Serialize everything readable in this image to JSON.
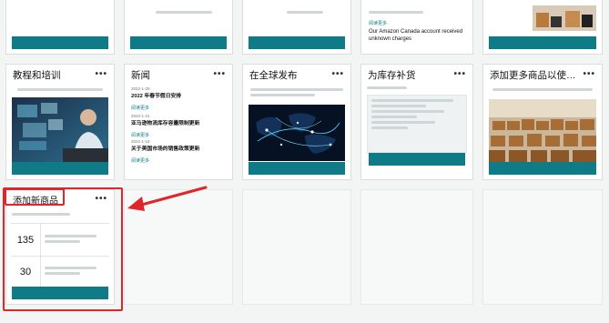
{
  "top_row": {
    "buttons": [
      "",
      "",
      "",
      "",
      ""
    ],
    "snippet_cols": [
      {
        "lines": [
          ""
        ]
      },
      {
        "lines": [
          ""
        ]
      },
      {
        "link": "阅读更多",
        "headline": "Our Amazon Canada account received unknown charges"
      }
    ]
  },
  "cards": {
    "education": {
      "title": "教程和培训",
      "more": "•••",
      "button": ""
    },
    "news": {
      "title": "新闻",
      "more": "•••",
      "items": [
        {
          "date": "2022-1-29",
          "title": "2022 年春节假日安排",
          "link": "阅读更多"
        },
        {
          "date": "2022-1-21",
          "title": "亚马逊物流库存容量限制更新",
          "link": "阅读更多"
        },
        {
          "date": "2022-1-19",
          "title": "关于美国市场的销售政策更新",
          "link": "阅读更多"
        }
      ]
    },
    "global": {
      "title": "在全球发布",
      "more": "•••",
      "button": ""
    },
    "restock": {
      "title": "为库存补货",
      "more": "•••",
      "button": "",
      "sub_link": ""
    },
    "add_more": {
      "title": "添加更多商品以使用亚...",
      "more": "•••",
      "button": ""
    },
    "add_product": {
      "title": "添加新商品",
      "more": "•••",
      "subtitle": "",
      "rows": [
        {
          "count": "135",
          "text": ""
        },
        {
          "count": "30",
          "text": ""
        }
      ],
      "button": ""
    }
  },
  "annotation": {
    "color": "#e0262b"
  }
}
